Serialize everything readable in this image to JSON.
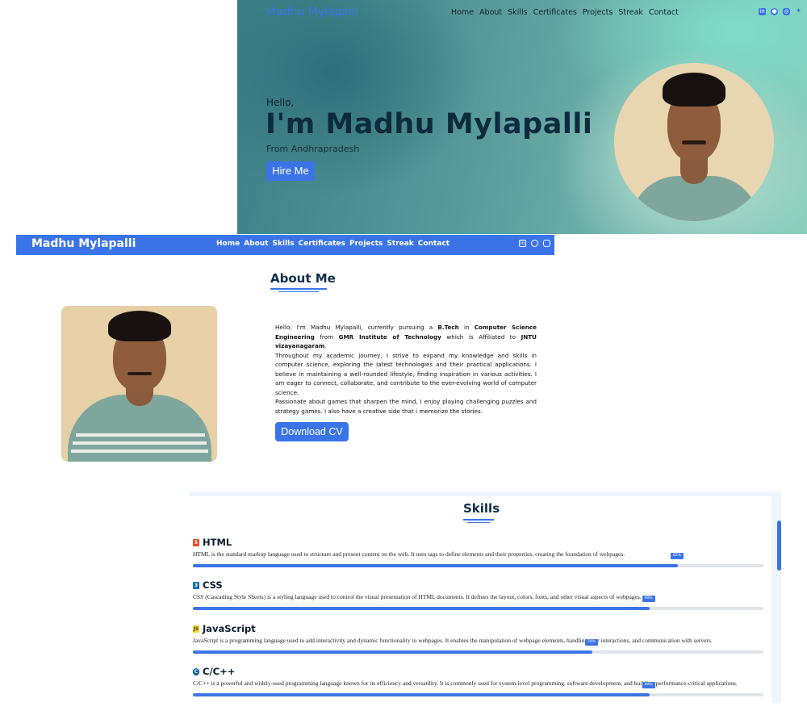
{
  "hero": {
    "brand": "Madhu Mylapalli",
    "nav": [
      "Home",
      "About",
      "Skills",
      "Certificates",
      "Projects",
      "Streak",
      "Contact"
    ],
    "social_icons": [
      "linkedin-icon",
      "github-icon",
      "instagram-icon",
      "twitter-icon"
    ],
    "greeting": "Hello,",
    "name": "I'm Madhu Mylapalli",
    "location": "From Andhrapradesh",
    "cta": "Hire Me"
  },
  "about": {
    "brand": "Madhu Mylapalli",
    "nav": [
      "Home",
      "About",
      "Skills",
      "Certificates",
      "Projects",
      "Streak",
      "Contact"
    ],
    "social_icons": [
      "linkedin-icon",
      "github-icon",
      "instagram-icon"
    ],
    "title": "About Me",
    "intro": {
      "t1": "Hello, I'm Madhu Mylapalli, currently pursuing a ",
      "b1": "B.Tech",
      "t2": " in ",
      "b2": "Computer Science Engineering",
      "t3": " from ",
      "b3": "GMR Institute of Technology",
      "t4": " which is Affiliated to ",
      "b4": "JNTU vizayanagaram",
      "t5": "."
    },
    "paragraph2": "Throughout my academic journey, I strive to expand my knowledge and skills in computer science, exploring the latest technologies and their practical applications. I believe in maintaining a well-rounded lifestyle, finding inspiration in various activities. I am eager to connect, collaborate, and contribute to the ever-evolving world of computer science.",
    "paragraph3": "Passionate about games that sharpen the mind, I enjoy playing challenging puzzles and strategy games. I also have a creative side that i memorize the stories.",
    "cta": "Download CV"
  },
  "skills": {
    "title": "Skills",
    "items": [
      {
        "name": "HTML",
        "icon": "html5-icon",
        "color": "#e44d26",
        "desc": "HTML is the standard markup language used to structure and present content on the web. It uses tags to define elements and their properties, creating the foundation of webpages.",
        "percent": 85,
        "percent_label": "85%"
      },
      {
        "name": "CSS",
        "icon": "css3-icon",
        "color": "#1572b6",
        "desc": "CSS (Cascading Style Sheets) is a styling language used to control the visual presentation of HTML documents. It defines the layout, colors, fonts, and other visual aspects of webpages.",
        "percent": 80,
        "percent_label": "80%"
      },
      {
        "name": "JavaScript",
        "icon": "javascript-icon",
        "color": "#f7df1e",
        "desc": "JavaScript is a programming language used to add interactivity and dynamic functionality to webpages. It enables the manipulation of webpage elements, handling user interactions, and communication with servers.",
        "percent": 70,
        "percent_label": "70%"
      },
      {
        "name": "C/C++",
        "icon": "cpp-icon",
        "color": "#00599c",
        "desc": "C/C++ is a powerful and widely-used programming language known for its efficiency and versatility. It is commonly used for system-level programming, software development, and building performance-critical applications.",
        "percent": 80,
        "percent_label": "80%"
      }
    ]
  },
  "colors": {
    "accent": "#3b74e8",
    "heading": "#102f4a"
  }
}
